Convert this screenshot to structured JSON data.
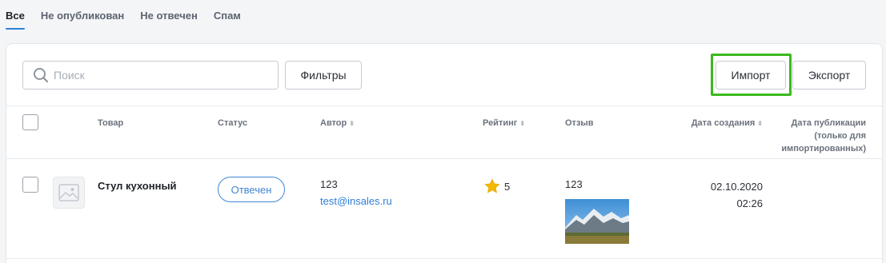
{
  "tabs": [
    {
      "label": "Все",
      "active": true
    },
    {
      "label": "Не опубликован",
      "active": false
    },
    {
      "label": "Не отвечен",
      "active": false
    },
    {
      "label": "Спам",
      "active": false
    }
  ],
  "toolbar": {
    "search_placeholder": "Поиск",
    "search_value": "",
    "filter_label": "Фильтры",
    "import_label": "Импорт",
    "export_label": "Экспорт"
  },
  "table": {
    "headers": {
      "product": "Товар",
      "status": "Статус",
      "author": "Автор",
      "rating": "Рейтинг",
      "review": "Отзыв",
      "created": "Дата создания",
      "published": "Дата публикации (только для импортированных)"
    },
    "rows": [
      {
        "product": "Стул кухонный",
        "status": "Отвечен",
        "author_name": "123",
        "author_email": "test@insales.ru",
        "rating": "5",
        "review": "123",
        "created_date": "02.10.2020",
        "created_time": "02:26",
        "published": ""
      }
    ]
  },
  "colors": {
    "accent": "#2f7fd8",
    "highlight": "#3cb81f",
    "star": "#f5b800"
  },
  "icons": {
    "search": "search-icon",
    "sort": "sort-icon",
    "image_placeholder": "image-placeholder-icon",
    "star": "star-icon"
  }
}
